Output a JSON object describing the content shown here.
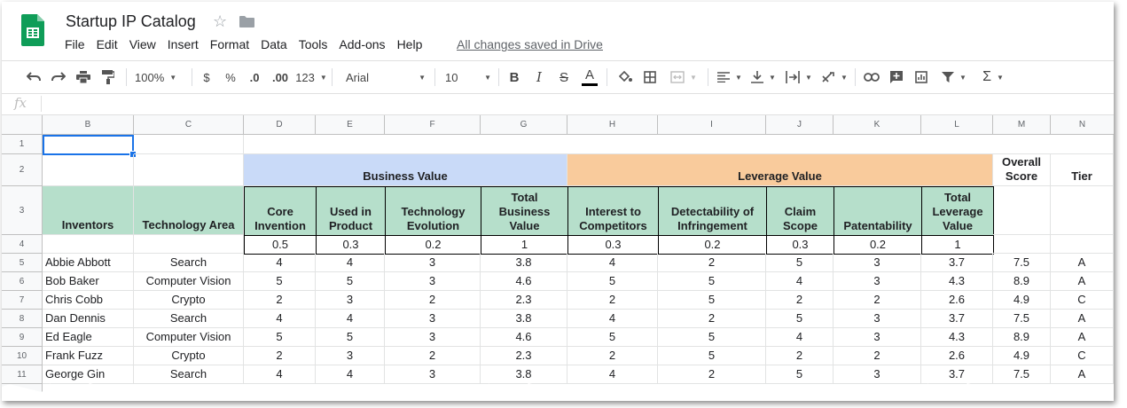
{
  "doc": {
    "title": "Startup IP Catalog",
    "saved_status": "All changes saved in Drive"
  },
  "menu": [
    "File",
    "Edit",
    "View",
    "Insert",
    "Format",
    "Data",
    "Tools",
    "Add-ons",
    "Help"
  ],
  "toolbar": {
    "zoom": "100%",
    "currency": "$",
    "percent": "%",
    "dec_less": ".0",
    "dec_more": ".00",
    "more_formats": "123",
    "font": "Arial",
    "font_size": "10",
    "bold": "B",
    "italic": "I",
    "strike": "S",
    "text_color": "A"
  },
  "formula_bar": {
    "fx": "fx"
  },
  "columns": [
    "B",
    "C",
    "D",
    "E",
    "F",
    "G",
    "H",
    "I",
    "J",
    "K",
    "L",
    "M",
    "N"
  ],
  "rows": [
    "1",
    "2",
    "3",
    "4",
    "5",
    "6",
    "7",
    "8",
    "9",
    "10",
    "11"
  ],
  "sheet": {
    "group_headers": {
      "business": "Business Value",
      "leverage": "Leverage Value",
      "overall": "Overall Score",
      "tier": "Tier"
    },
    "headers": [
      "Inventors",
      "Technology Area",
      "Core Invention",
      "Used in Product",
      "Technology Evolution",
      "Total Business Value",
      "Interest to Competitors",
      "Detectability of Infringement",
      "Claim Scope",
      "Patentability",
      "Total Leverage Value"
    ],
    "weights": [
      "0.5",
      "0.3",
      "0.2",
      "1",
      "0.3",
      "0.2",
      "0.3",
      "0.2",
      "1"
    ],
    "data": [
      [
        "Abbie Abbott",
        "Search",
        "4",
        "4",
        "3",
        "3.8",
        "4",
        "2",
        "5",
        "3",
        "3.7",
        "7.5",
        "A"
      ],
      [
        "Bob Baker",
        "Computer Vision",
        "5",
        "5",
        "3",
        "4.6",
        "5",
        "5",
        "4",
        "3",
        "4.3",
        "8.9",
        "A"
      ],
      [
        "Chris Cobb",
        "Crypto",
        "2",
        "3",
        "2",
        "2.3",
        "2",
        "5",
        "2",
        "2",
        "2.6",
        "4.9",
        "C"
      ],
      [
        "Dan Dennis",
        "Search",
        "4",
        "4",
        "3",
        "3.8",
        "4",
        "2",
        "5",
        "3",
        "3.7",
        "7.5",
        "A"
      ],
      [
        "Ed Eagle",
        "Computer Vision",
        "5",
        "5",
        "3",
        "4.6",
        "5",
        "5",
        "4",
        "3",
        "4.3",
        "8.9",
        "A"
      ],
      [
        "Frank Fuzz",
        "Crypto",
        "2",
        "3",
        "2",
        "2.3",
        "2",
        "5",
        "2",
        "2",
        "2.6",
        "4.9",
        "C"
      ],
      [
        "George Gin",
        "Search",
        "4",
        "4",
        "3",
        "3.8",
        "4",
        "2",
        "5",
        "3",
        "3.7",
        "7.5",
        "A"
      ]
    ]
  }
}
